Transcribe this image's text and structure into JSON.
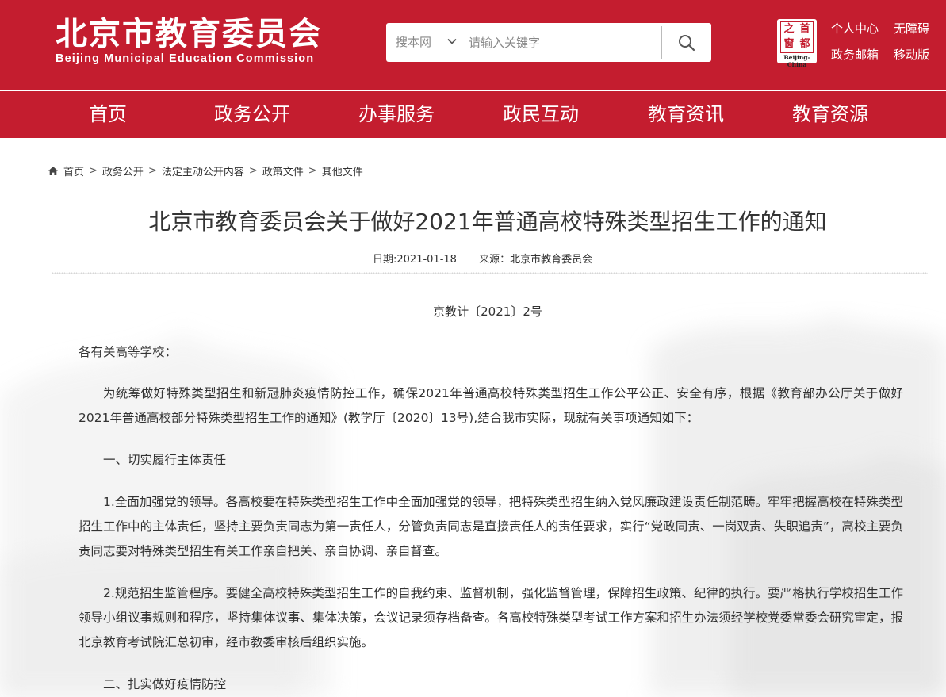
{
  "header": {
    "logo_cn": "北京市教育委员会",
    "logo_en": "Beijing Municipal Education Commission",
    "search": {
      "scope": "搜本网",
      "placeholder": "请输入关键字"
    },
    "seal": {
      "chars": [
        "之",
        "首",
        "窗",
        "都"
      ],
      "en": "Beijing-China"
    },
    "links": [
      "个人中心",
      "无障碍",
      "政务邮箱",
      "移动版"
    ]
  },
  "colors": {
    "brand_red": "#c41d2f"
  },
  "nav": [
    "首页",
    "政务公开",
    "办事服务",
    "政民互动",
    "教育资讯",
    "教育资源"
  ],
  "breadcrumb": [
    "首页",
    "政务公开",
    "法定主动公开内容",
    "政策文件",
    "其他文件"
  ],
  "article": {
    "title": "北京市教育委员会关于做好2021年普通高校特殊类型招生工作的通知",
    "date": "日期:2021-01-18",
    "source": "来源：北京市教育委员会",
    "doc_number": "京教计〔2021〕2号",
    "salutation": "各有关高等学校：",
    "paragraphs": [
      "为统筹做好特殊类型招生和新冠肺炎疫情防控工作，确保2021年普通高校特殊类型招生工作公平公正、安全有序，根据《教育部办公厅关于做好2021年普通高校部分特殊类型招生工作的通知》(教学厅〔2020〕13号),结合我市实际，现就有关事项通知如下：",
      "一、切实履行主体责任",
      "1.全面加强党的领导。各高校要在特殊类型招生工作中全面加强党的领导，把特殊类型招生纳入党风廉政建设责任制范畴。牢牢把握高校在特殊类型招生工作中的主体责任，坚持主要负责同志为第一责任人，分管负责同志是直接责任人的责任要求，实行“党政同责、一岗双责、失职追责”，高校主要负责同志要对特殊类型招生有关工作亲自把关、亲自协调、亲自督查。",
      "2.规范招生监管程序。要健全高校特殊类型招生工作的自我约束、监督机制，强化监督管理，保障招生政策、纪律的执行。要严格执行学校招生工作领导小组议事规则和程序，坚持集体议事、集体决策，会议记录须存档备查。各高校特殊类型考试工作方案和招生办法须经学校党委常委会研究审定，报北京教育考试院汇总初审，经市教委审核后组织实施。",
      "二、扎实做好疫情防控"
    ]
  }
}
